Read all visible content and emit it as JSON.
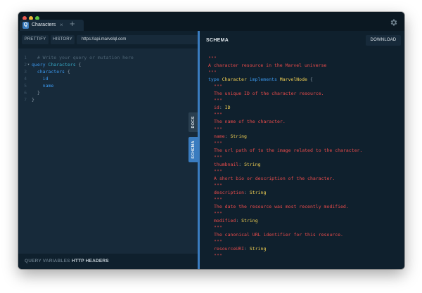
{
  "window": {
    "tab_title": "Characters",
    "tab_close": "×",
    "new_tab": "+",
    "tab_badge": "Q"
  },
  "toolbar": {
    "prettify": "PRETTIFY",
    "history": "HISTORY",
    "url": "https://api.marvelql.com"
  },
  "editor": {
    "lines": [
      {
        "n": "1",
        "arrow": "",
        "parts": [
          {
            "t": "  # Write your query or mutation here",
            "c": "c-comment"
          }
        ]
      },
      {
        "n": "2",
        "arrow": "▾",
        "parts": [
          {
            "t": "query ",
            "c": "c-kw"
          },
          {
            "t": "Characters",
            "c": "c-name"
          },
          {
            "t": " {",
            "c": "c-punct"
          }
        ]
      },
      {
        "n": "3",
        "arrow": "",
        "parts": [
          {
            "t": "  characters",
            "c": "c-field"
          },
          {
            "t": " {",
            "c": "c-punct"
          }
        ]
      },
      {
        "n": "4",
        "arrow": "",
        "parts": [
          {
            "t": "    id",
            "c": "c-field"
          }
        ]
      },
      {
        "n": "5",
        "arrow": "",
        "parts": [
          {
            "t": "    name",
            "c": "c-field"
          }
        ]
      },
      {
        "n": "6",
        "arrow": "",
        "parts": [
          {
            "t": "  }",
            "c": "c-punct"
          }
        ]
      },
      {
        "n": "7",
        "arrow": "",
        "parts": [
          {
            "t": "}",
            "c": "c-punct"
          }
        ]
      }
    ]
  },
  "footer": {
    "query_variables": "QUERY VARIABLES",
    "http_headers": "HTTP HEADERS"
  },
  "sidetabs": {
    "docs": "DOCS",
    "schema": "SCHEMA"
  },
  "schema_panel": {
    "title": "SCHEMA",
    "download": "DOWNLOAD",
    "lines": [
      {
        "indent": 0,
        "parts": [
          {
            "t": "\"\"\"",
            "c": "s-doc"
          }
        ]
      },
      {
        "indent": 0,
        "parts": [
          {
            "t": "A character resource in the Marvel universe",
            "c": "s-doc"
          }
        ]
      },
      {
        "indent": 0,
        "parts": [
          {
            "t": "\"\"\"",
            "c": "s-doc"
          }
        ]
      },
      {
        "indent": 0,
        "parts": [
          {
            "t": "type ",
            "c": "s-type-kw"
          },
          {
            "t": "Character",
            "c": "s-type-name"
          },
          {
            "t": " implements ",
            "c": "s-type-kw"
          },
          {
            "t": "MarvelNode",
            "c": "s-type-name"
          },
          {
            "t": " {",
            "c": "s-brace"
          }
        ]
      },
      {
        "indent": 1,
        "parts": [
          {
            "t": "\"\"\"",
            "c": "s-doc"
          }
        ]
      },
      {
        "indent": 1,
        "parts": [
          {
            "t": "The unique ID of the character resource.",
            "c": "s-doc"
          }
        ]
      },
      {
        "indent": 1,
        "parts": [
          {
            "t": "\"\"\"",
            "c": "s-doc"
          }
        ]
      },
      {
        "indent": 1,
        "parts": [
          {
            "t": "id",
            "c": "s-field"
          },
          {
            "t": ": ",
            "c": "s-colon"
          },
          {
            "t": "ID",
            "c": "s-scalar"
          }
        ]
      },
      {
        "indent": 1,
        "parts": [
          {
            "t": "\"\"\"",
            "c": "s-doc"
          }
        ]
      },
      {
        "indent": 1,
        "parts": [
          {
            "t": "The name of the character.",
            "c": "s-doc"
          }
        ]
      },
      {
        "indent": 1,
        "parts": [
          {
            "t": "\"\"\"",
            "c": "s-doc"
          }
        ]
      },
      {
        "indent": 1,
        "parts": [
          {
            "t": "name",
            "c": "s-field"
          },
          {
            "t": ": ",
            "c": "s-colon"
          },
          {
            "t": "String",
            "c": "s-scalar"
          }
        ]
      },
      {
        "indent": 1,
        "parts": [
          {
            "t": "\"\"\"",
            "c": "s-doc"
          }
        ]
      },
      {
        "indent": 1,
        "parts": [
          {
            "t": "The url path of to the image related to the character.",
            "c": "s-doc"
          }
        ]
      },
      {
        "indent": 1,
        "parts": [
          {
            "t": "\"\"\"",
            "c": "s-doc"
          }
        ]
      },
      {
        "indent": 1,
        "parts": [
          {
            "t": "thumbnail",
            "c": "s-field"
          },
          {
            "t": ": ",
            "c": "s-colon"
          },
          {
            "t": "String",
            "c": "s-scalar"
          }
        ]
      },
      {
        "indent": 1,
        "parts": [
          {
            "t": "\"\"\"",
            "c": "s-doc"
          }
        ]
      },
      {
        "indent": 1,
        "parts": [
          {
            "t": "A short bio or description of the character.",
            "c": "s-doc"
          }
        ]
      },
      {
        "indent": 1,
        "parts": [
          {
            "t": "\"\"\"",
            "c": "s-doc"
          }
        ]
      },
      {
        "indent": 1,
        "parts": [
          {
            "t": "description",
            "c": "s-field"
          },
          {
            "t": ": ",
            "c": "s-colon"
          },
          {
            "t": "String",
            "c": "s-scalar"
          }
        ]
      },
      {
        "indent": 1,
        "parts": [
          {
            "t": "\"\"\"",
            "c": "s-doc"
          }
        ]
      },
      {
        "indent": 1,
        "parts": [
          {
            "t": "The date the resource was most recently modified.",
            "c": "s-doc"
          }
        ]
      },
      {
        "indent": 1,
        "parts": [
          {
            "t": "\"\"\"",
            "c": "s-doc"
          }
        ]
      },
      {
        "indent": 1,
        "parts": [
          {
            "t": "modified",
            "c": "s-field"
          },
          {
            "t": ": ",
            "c": "s-colon"
          },
          {
            "t": "String",
            "c": "s-scalar"
          }
        ]
      },
      {
        "indent": 1,
        "parts": [
          {
            "t": "\"\"\"",
            "c": "s-doc"
          }
        ]
      },
      {
        "indent": 1,
        "parts": [
          {
            "t": "The canonical URL identifier for this resource.",
            "c": "s-doc"
          }
        ]
      },
      {
        "indent": 1,
        "parts": [
          {
            "t": "\"\"\"",
            "c": "s-doc"
          }
        ]
      },
      {
        "indent": 1,
        "parts": [
          {
            "t": "resourceURI",
            "c": "s-field"
          },
          {
            "t": ": ",
            "c": "s-colon"
          },
          {
            "t": "String",
            "c": "s-scalar"
          }
        ]
      },
      {
        "indent": 1,
        "parts": [
          {
            "t": "\"\"\"",
            "c": "s-doc"
          }
        ]
      }
    ]
  },
  "colors": {
    "accent": "#3a7cbf",
    "background": "#0f202d",
    "panel": "#172a3a",
    "doc_red": "#ea4b4b",
    "type_yellow": "#f1cf52",
    "keyword_blue": "#3b97ec"
  },
  "icons": {
    "settings": "gear-icon"
  }
}
